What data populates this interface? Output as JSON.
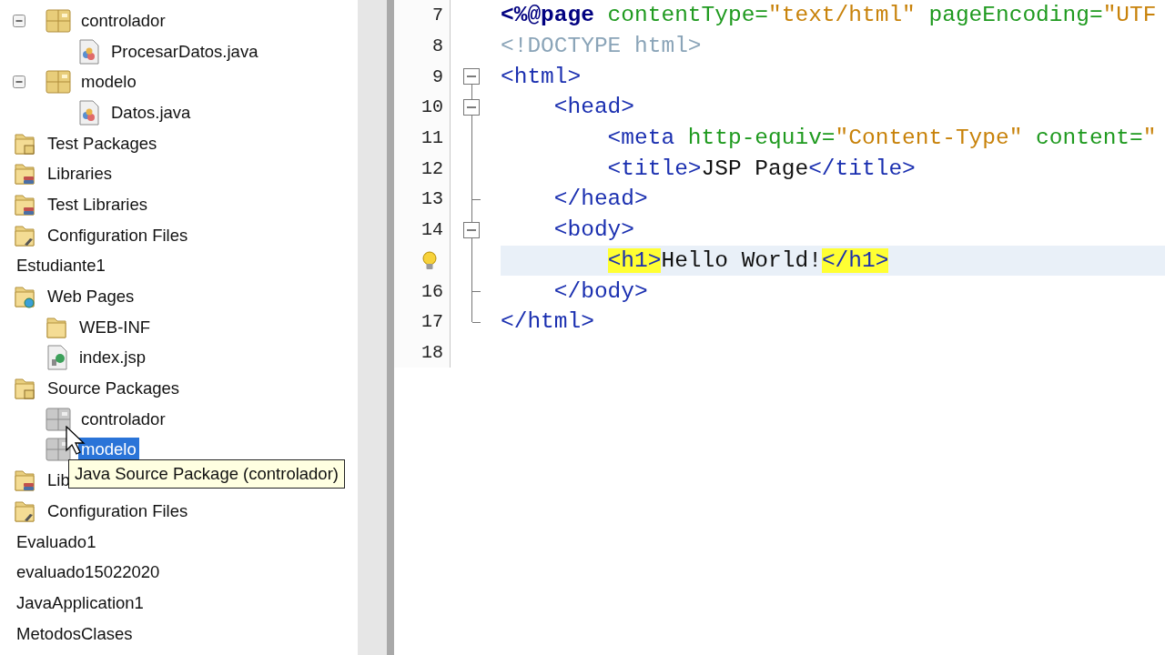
{
  "tree": [
    {
      "children": [
        {
          "children": [
            {
              "label": "controlador",
              "kind": "package",
              "expanded": true,
              "selected": false,
              "children": [
                {
                  "label": "ProcesarDatos.java",
                  "kind": "java-file",
                  "selected": false
                }
              ]
            },
            {
              "label": "modelo",
              "kind": "package",
              "expanded": true,
              "selected": false,
              "children": [
                {
                  "label": "Datos.java",
                  "kind": "java-file",
                  "selected": false
                }
              ]
            }
          ]
        },
        {
          "label": "Test Packages",
          "kind": "packages-folder",
          "selected": false
        },
        {
          "label": "Libraries",
          "kind": "libraries-folder",
          "selected": false
        },
        {
          "label": "Test Libraries",
          "kind": "libraries-folder",
          "selected": false
        },
        {
          "label": "Configuration Files",
          "kind": "config-folder",
          "selected": false
        }
      ]
    },
    {
      "label": "Estudiante1",
      "selected": false,
      "children": [
        {
          "label": "Web Pages",
          "kind": "web-folder",
          "selected": false,
          "children": [
            {
              "label": "WEB-INF",
              "kind": "folder",
              "selected": false
            },
            {
              "label": "index.jsp",
              "kind": "jsp-file",
              "selected": false
            }
          ]
        },
        {
          "label": "Source Packages",
          "kind": "packages-folder",
          "selected": false,
          "children": [
            {
              "label": "controlador",
              "kind": "empty-package",
              "selected": false
            },
            {
              "label": "modelo",
              "kind": "empty-package",
              "selected": true
            }
          ]
        },
        {
          "label": "Lib",
          "kind": "libraries-folder",
          "selected": false
        },
        {
          "label": "Configuration Files",
          "kind": "config-folder",
          "selected": false
        }
      ]
    },
    {
      "label": "Evaluado1",
      "selected": false
    },
    {
      "label": "evaluado15022020",
      "selected": false
    },
    {
      "label": "JavaApplication1",
      "selected": false
    },
    {
      "label": "MetodosClases",
      "selected": false
    }
  ],
  "tooltip": "Java Source Package (controlador)",
  "editor": {
    "lines": [
      {
        "number": "7",
        "kind": "plain",
        "current": false,
        "hint": false,
        "tokens": [
          {
            "text": "<%@page",
            "kind": "directive"
          },
          {
            "text": " contentType=",
            "kind": "attr"
          },
          {
            "text": "\"text/html\"",
            "kind": "string"
          },
          {
            "text": " pageEncoding=",
            "kind": "attr"
          },
          {
            "text": "\"UTF",
            "kind": "string"
          }
        ]
      },
      {
        "number": "8",
        "kind": "plain",
        "current": false,
        "hint": false,
        "tokens": [
          {
            "text": "<!DOCTYPE html>",
            "kind": "doctype"
          }
        ]
      },
      {
        "number": "9",
        "kind": "fold-start",
        "current": false,
        "hint": false,
        "tokens": [
          {
            "text": "<html>",
            "kind": "tag"
          }
        ]
      },
      {
        "number": "10",
        "kind": "fold-start",
        "current": false,
        "hint": false,
        "tokens": [
          {
            "text": "    <head>",
            "kind": "tag"
          }
        ]
      },
      {
        "number": "11",
        "kind": "fold-inner",
        "current": false,
        "hint": false,
        "tokens": [
          {
            "text": "        <meta",
            "kind": "tag"
          },
          {
            "text": " http-equiv=",
            "kind": "attr"
          },
          {
            "text": "\"Content-Type\"",
            "kind": "string"
          },
          {
            "text": " content=",
            "kind": "attr"
          },
          {
            "text": "\"",
            "kind": "string"
          }
        ]
      },
      {
        "number": "12",
        "kind": "fold-inner",
        "current": false,
        "hint": false,
        "tokens": [
          {
            "text": "        <title>",
            "kind": "tag"
          },
          {
            "text": "JSP Page",
            "kind": "text"
          },
          {
            "text": "</title>",
            "kind": "tag"
          }
        ]
      },
      {
        "number": "13",
        "kind": "fold-end",
        "current": false,
        "hint": false,
        "tokens": [
          {
            "text": "    </head>",
            "kind": "tag"
          }
        ]
      },
      {
        "number": "14",
        "kind": "fold-start",
        "current": false,
        "hint": false,
        "tokens": [
          {
            "text": "    <body>",
            "kind": "tag"
          }
        ]
      },
      {
        "kind": "fold-inner",
        "current": true,
        "hint": true,
        "tokens": [
          {
            "text": "        <h1>",
            "kind": "match"
          },
          {
            "text": "Hello World!",
            "kind": "text"
          },
          {
            "text": "</h1>",
            "kind": "match"
          }
        ]
      },
      {
        "number": "16",
        "kind": "fold-end",
        "current": false,
        "hint": false,
        "tokens": [
          {
            "text": "    </body>",
            "kind": "tag"
          }
        ]
      },
      {
        "number": "17",
        "kind": "fold-last",
        "current": false,
        "hint": false,
        "tokens": [
          {
            "text": "</html>",
            "kind": "tag"
          }
        ]
      },
      {
        "number": "18",
        "kind": "plain",
        "current": false,
        "hint": false
      }
    ]
  }
}
